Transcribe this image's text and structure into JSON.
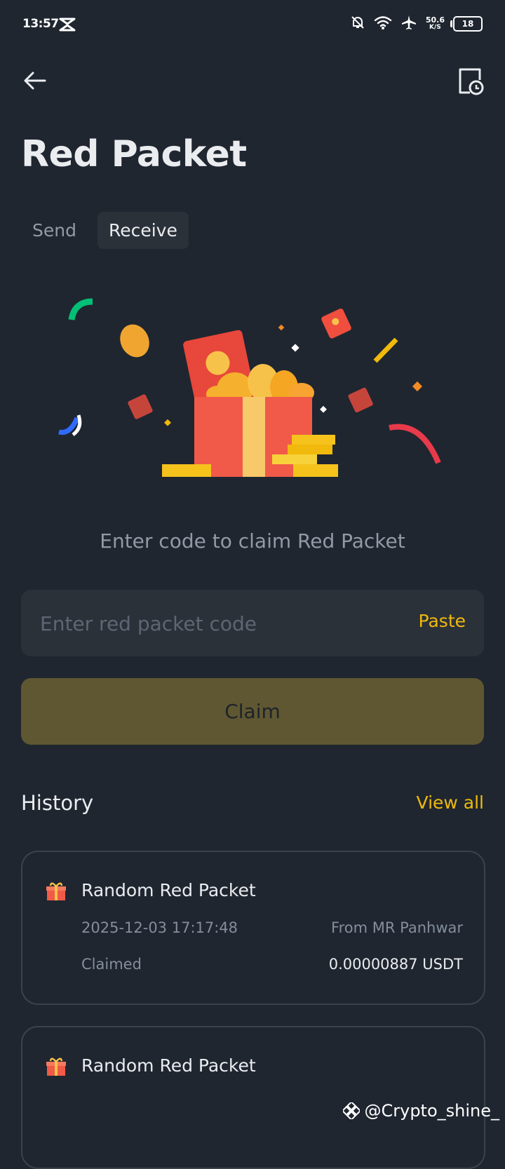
{
  "status_bar": {
    "time": "13:57",
    "speed_value": "50.6",
    "speed_unit": "K/S",
    "battery": "18"
  },
  "header": {
    "title": "Red Packet",
    "back_icon": "arrow-left-icon",
    "history_icon": "document-clock-icon"
  },
  "tabs": [
    {
      "label": "Send",
      "active": false
    },
    {
      "label": "Receive",
      "active": true
    }
  ],
  "receive": {
    "subtitle": "Enter code to claim Red Packet",
    "input_placeholder": "Enter red packet code",
    "input_value": "",
    "paste_label": "Paste",
    "claim_label": "Claim"
  },
  "history": {
    "title": "History",
    "view_all_label": "View all",
    "items": [
      {
        "title": "Random Red Packet",
        "datetime": "2025-12-03 17:17:48",
        "from": "From MR Panhwar",
        "status": "Claimed",
        "amount": "0.00000887 USDT"
      },
      {
        "title": "Random Red Packet"
      }
    ]
  },
  "watermark": {
    "text": "@Crypto_shine_"
  },
  "colors": {
    "background": "#1f2630",
    "surface": "#2b3139",
    "accent": "#f0b90b",
    "claim_disabled": "#5e5732",
    "muted_text": "#848e9c"
  }
}
